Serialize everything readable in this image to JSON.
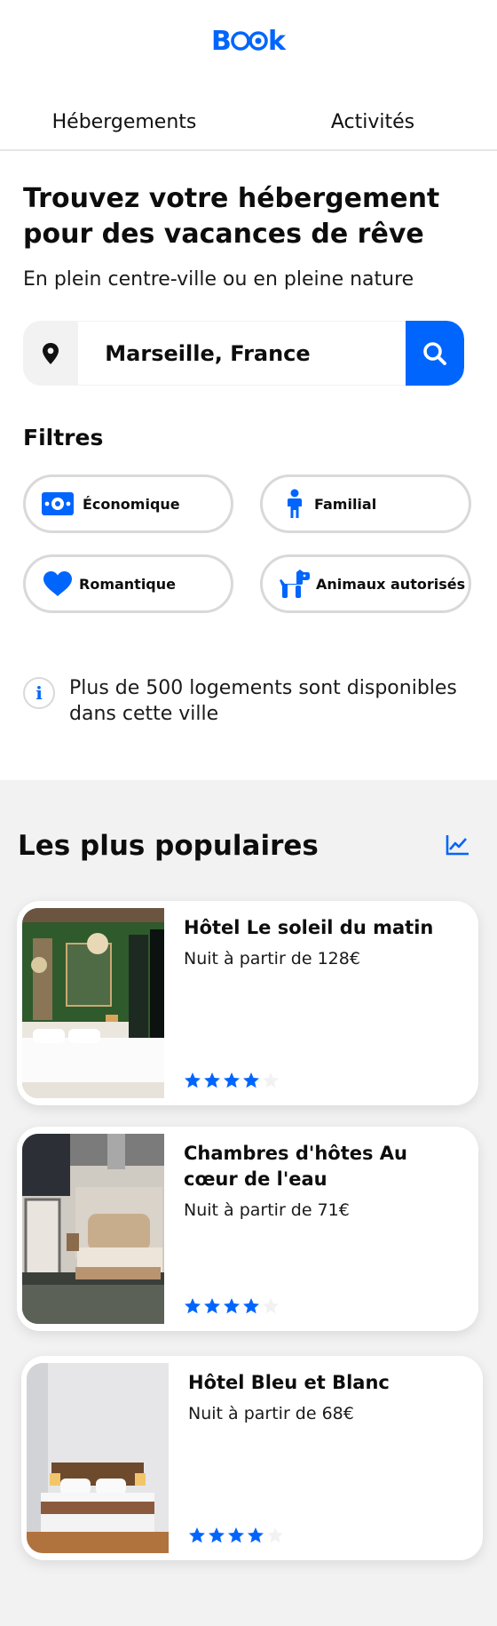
{
  "brand": {
    "name": "Booki",
    "color": "#0065fc"
  },
  "tabs": [
    {
      "label": "Hébergements"
    },
    {
      "label": "Activités"
    }
  ],
  "hero": {
    "title": "Trouvez votre hébergement pour des vacances de rêve",
    "subtitle": "En plein centre-ville ou en pleine nature"
  },
  "search": {
    "value": "Marseille, France",
    "pin_icon": "location-pin-icon",
    "button_icon": "search-icon"
  },
  "filters": {
    "title": "Filtres",
    "items": [
      {
        "label": "Économique",
        "icon": "money-bill-icon"
      },
      {
        "label": "Familial",
        "icon": "child-icon"
      },
      {
        "label": "Romantique",
        "icon": "heart-icon"
      },
      {
        "label": "Animaux autorisés",
        "icon": "dog-icon"
      }
    ]
  },
  "info": {
    "icon": "info-icon",
    "text": "Plus de 500 logements sont disponibles dans cette ville"
  },
  "popular": {
    "title": "Les plus populaires",
    "icon": "chart-line-icon",
    "cards": [
      {
        "name": "Hôtel Le soleil du matin",
        "price": "Nuit à partir de 128€",
        "rating": 4,
        "max_rating": 5
      },
      {
        "name": "Chambres d'hôtes Au cœur de l'eau",
        "price": "Nuit à partir de 71€",
        "rating": 4,
        "max_rating": 5
      },
      {
        "name": "Hôtel Bleu et Blanc",
        "price": "Nuit à partir de 68€",
        "rating": 4,
        "max_rating": 5
      }
    ]
  },
  "colors": {
    "accent": "#0065fc",
    "chip_border": "#d9d9d9",
    "section_bg": "#f2f2f2",
    "star_empty": "#f2f2f2"
  }
}
